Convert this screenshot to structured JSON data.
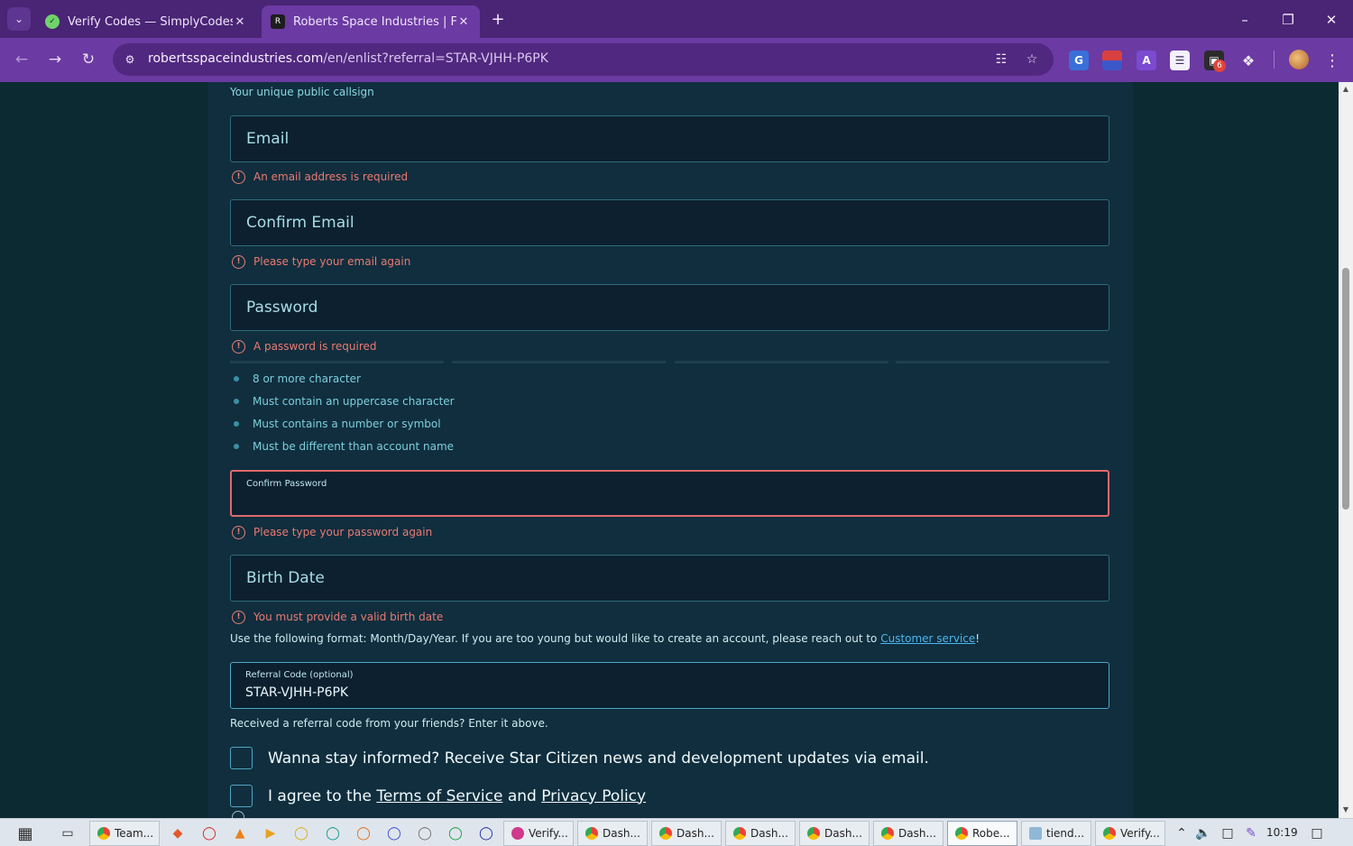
{
  "tabs": [
    {
      "title": "Verify Codes — SimplyCodes",
      "active": false
    },
    {
      "title": "Roberts Space Industries | Follo",
      "active": true
    }
  ],
  "toolbar": {
    "url_host": "robertsspaceindustries.com",
    "url_path": "/en/enlist?referral=STAR-VJHH-P6PK",
    "extension_badge": "6"
  },
  "form": {
    "callsign_hint": "Your unique public callsign",
    "email": {
      "placeholder": "Email",
      "error": "An email address is required"
    },
    "confirm_email": {
      "placeholder": "Confirm Email",
      "error": "Please type your email again"
    },
    "password": {
      "placeholder": "Password",
      "error": "A password is required"
    },
    "password_requirements": [
      "8 or more character",
      "Must contain an uppercase character",
      "Must contains a number or symbol",
      "Must be different than account name"
    ],
    "confirm_password": {
      "label": "Confirm Password",
      "error": "Please type your password again"
    },
    "birth_date": {
      "placeholder": "Birth Date",
      "error": "You must provide a valid birth date",
      "format_note": "Use the following format: Month/Day/Year. If you are too young but would like to create an account, please reach out to ",
      "link": "Customer service",
      "suffix": "!"
    },
    "referral": {
      "label": "Referral Code (optional)",
      "value": "STAR-VJHH-P6PK",
      "note": "Received a referral code from your friends? Enter it above."
    },
    "newsletter_label": "Wanna stay informed? Receive Star Citizen news and development updates via email.",
    "agree": {
      "prefix": "I agree to the ",
      "tos": "Terms of Service",
      "and": " and ",
      "privacy": "Privacy Policy"
    }
  },
  "taskbar": {
    "buttons": [
      "Team...",
      "Verify...",
      "Dash...",
      "Dash...",
      "Dash...",
      "Dash...",
      "Dash...",
      "Robe...",
      "tiend...",
      "Verify..."
    ],
    "clock": "10:19"
  },
  "colors": {
    "tab_bar": "#4a2475",
    "toolbar": "#6b3aa3",
    "page_background": "#0c2a31",
    "panel": "#102e3e",
    "error": "#ea7a72",
    "link": "#48b6f0"
  }
}
